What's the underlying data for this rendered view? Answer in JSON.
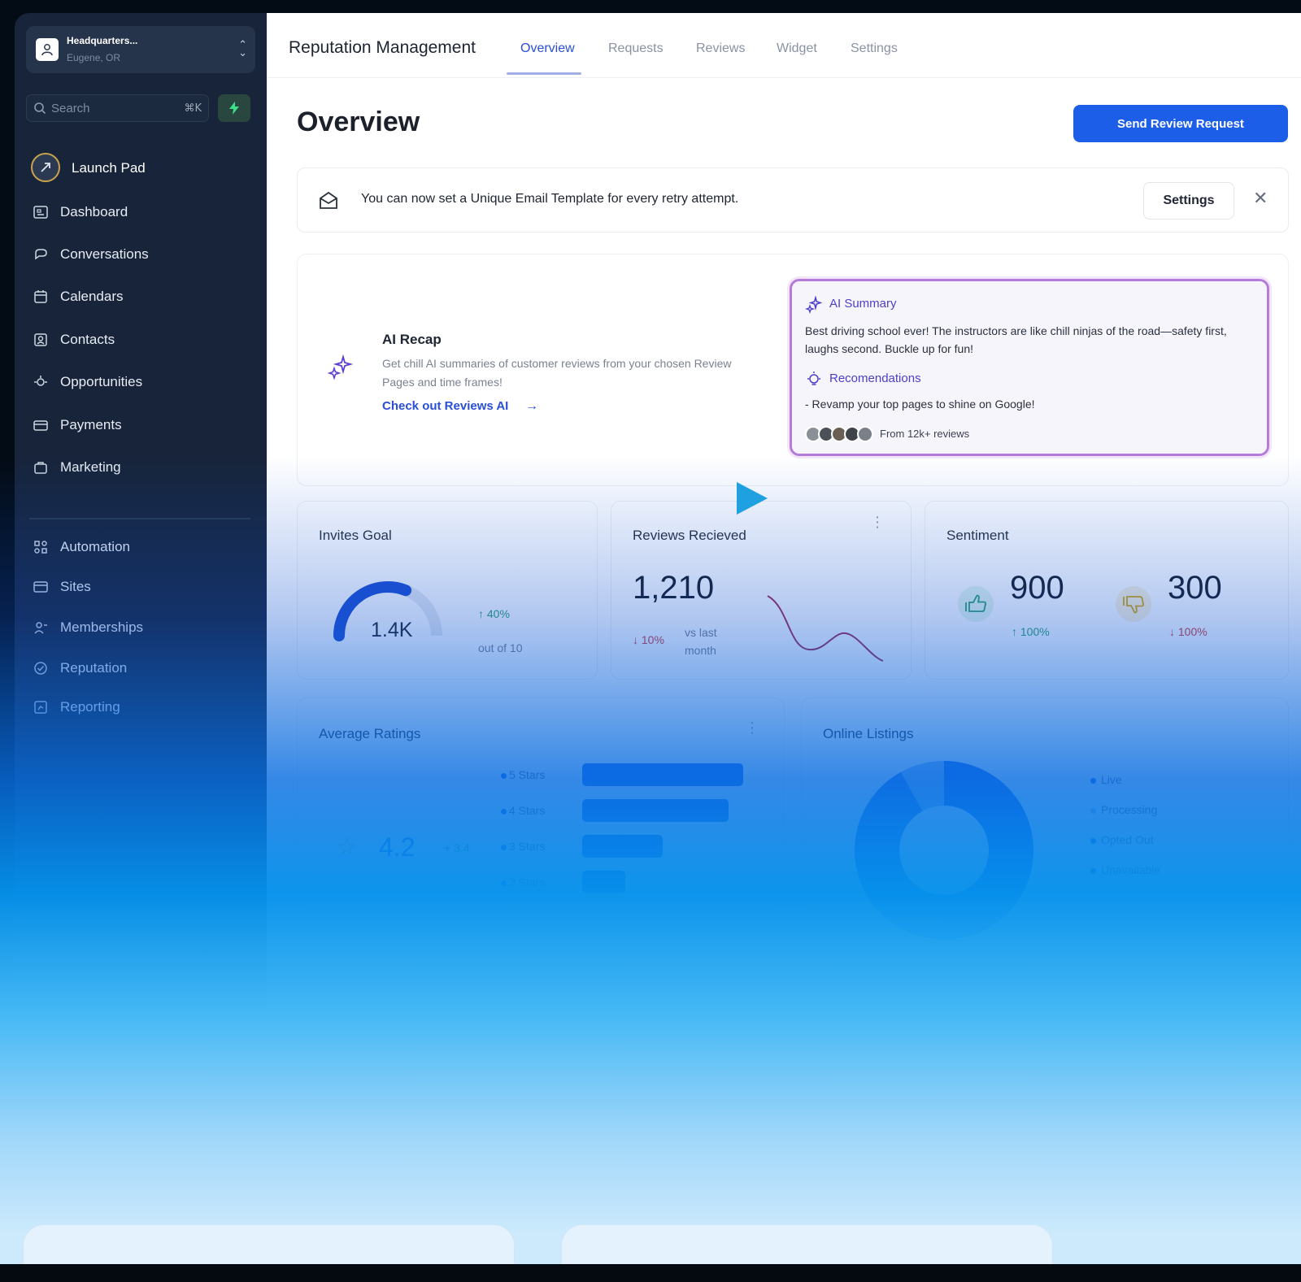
{
  "location": {
    "name": "Headquarters...",
    "city": "Eugene, OR"
  },
  "search": {
    "placeholder": "Search",
    "shortcut": "⌘K"
  },
  "sidebar": {
    "launch_pad": "Launch Pad",
    "items": [
      {
        "label": "Dashboard",
        "icon": "dashboard-icon"
      },
      {
        "label": "Conversations",
        "icon": "chat-icon"
      },
      {
        "label": "Calendars",
        "icon": "calendar-icon"
      },
      {
        "label": "Contacts",
        "icon": "contacts-icon"
      },
      {
        "label": "Opportunities",
        "icon": "opportunities-icon"
      },
      {
        "label": "Payments",
        "icon": "payments-icon"
      },
      {
        "label": "Marketing",
        "icon": "marketing-icon"
      }
    ],
    "secondary": [
      {
        "label": "Automation",
        "icon": "automation-icon"
      },
      {
        "label": "Sites",
        "icon": "sites-icon"
      },
      {
        "label": "Memberships",
        "icon": "memberships-icon"
      },
      {
        "label": "Reputation",
        "icon": "reputation-icon"
      },
      {
        "label": "Reporting",
        "icon": "reporting-icon"
      }
    ]
  },
  "header": {
    "app_title": "Reputation Management",
    "tabs": [
      {
        "label": "Overview",
        "active": true
      },
      {
        "label": "Requests"
      },
      {
        "label": "Reviews"
      },
      {
        "label": "Widget"
      },
      {
        "label": "Settings"
      }
    ]
  },
  "page": {
    "title": "Overview",
    "primary_action": "Send Review Request"
  },
  "notice": {
    "text": "You can now set a Unique Email Template for every retry attempt.",
    "button": "Settings",
    "close": "✕"
  },
  "recap": {
    "title": "AI Recap",
    "description": "Get chill AI summaries of customer reviews from your chosen Review Pages and time frames!",
    "link": "Check out Reviews AI",
    "summary": {
      "title": "AI Summary",
      "text": "Best driving school ever! The instructors are like chill ninjas of the road—safety first, laughs second. Buckle up for fun!",
      "rec_title": "Recomendations",
      "rec_text": "- Revamp your top pages to shine on Google!",
      "from": "From 12k+ reviews"
    }
  },
  "invites": {
    "title": "Invites Goal",
    "value": "1.4K",
    "delta": "40%",
    "out_of": "out of 10",
    "progress": 0.62
  },
  "received": {
    "title": "Reviews Recieved",
    "value": "1,210",
    "delta": "10%",
    "vs": "vs last month"
  },
  "sentiment": {
    "title": "Sentiment",
    "positive": "900",
    "positive_delta": "100%",
    "negative": "300",
    "negative_delta": "100%"
  },
  "ratings": {
    "title": "Average Ratings",
    "value": "4.2",
    "delta": "+ 3.4",
    "bars": [
      {
        "label": "5 Stars",
        "fraction": 1.0
      },
      {
        "label": "4 Stars",
        "fraction": 0.91
      },
      {
        "label": "3 Stars",
        "fraction": 0.5
      },
      {
        "label": "2 Stars",
        "fraction": 0.27
      }
    ]
  },
  "listings": {
    "title": "Online Listings",
    "legend": [
      {
        "label": "Live",
        "color": "#1d5ee8"
      },
      {
        "label": "Processing",
        "color": "#9fc2f5"
      },
      {
        "label": "Opted Out",
        "color": "#1d5ee8"
      },
      {
        "label": "Unavailable",
        "color": "#1d5ee8"
      }
    ],
    "segments": [
      0.5,
      0.42,
      0.08
    ]
  },
  "colors": {
    "accent": "#1d5ee8",
    "ai_border": "#b57bd9",
    "positive": "#2da06e",
    "negative": "#d33b3b"
  }
}
